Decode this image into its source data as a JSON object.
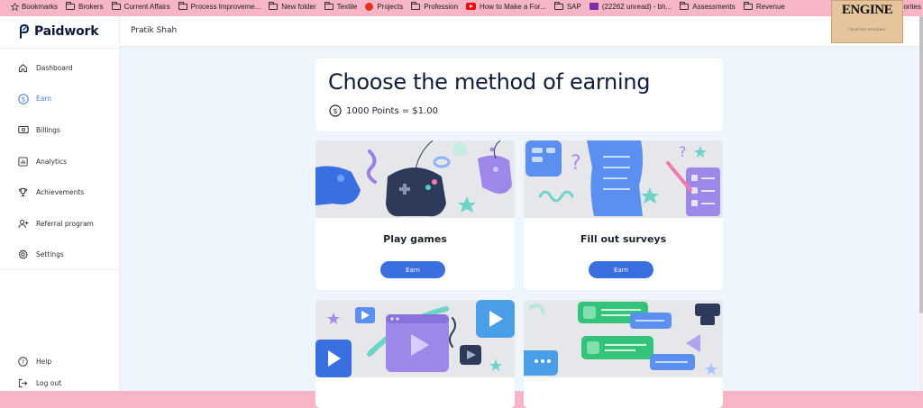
{
  "bookmarks": {
    "items": [
      {
        "label": "Bookmarks",
        "icon": "star-icon"
      },
      {
        "label": "Brokers",
        "icon": "folder-icon"
      },
      {
        "label": "Current Affairs",
        "icon": "folder-icon"
      },
      {
        "label": "Process Improveme...",
        "icon": "folder-icon"
      },
      {
        "label": "New folder",
        "icon": "folder-icon"
      },
      {
        "label": "Textile",
        "icon": "folder-icon"
      },
      {
        "label": "Projects",
        "icon": "site-icon"
      },
      {
        "label": "Profession",
        "icon": "folder-icon"
      },
      {
        "label": "How to Make a For...",
        "icon": "youtube-icon"
      },
      {
        "label": "SAP",
        "icon": "folder-icon"
      },
      {
        "label": "(22262 unread) - bh...",
        "icon": "mail-icon"
      },
      {
        "label": "Assessments",
        "icon": "folder-icon"
      },
      {
        "label": "Revenue",
        "icon": "folder-icon"
      }
    ],
    "overflow_label": "orites"
  },
  "overlay_thumb": {
    "big": "ENGINE",
    "small": "TRUSTED REVIEWS"
  },
  "app": {
    "logo": "Paidwork",
    "user_name": "Pratik Shah",
    "nav": [
      {
        "label": "Dashboard",
        "icon": "home-icon",
        "active": false
      },
      {
        "label": "Earn",
        "icon": "dollar-icon",
        "active": true
      },
      {
        "label": "Billings",
        "icon": "billing-icon",
        "active": false
      },
      {
        "label": "Analytics",
        "icon": "analytics-icon",
        "active": false
      },
      {
        "label": "Achievements",
        "icon": "trophy-icon",
        "active": false
      },
      {
        "label": "Referral program",
        "icon": "referral-icon",
        "active": false
      },
      {
        "label": "Settings",
        "icon": "gear-icon",
        "active": false
      }
    ],
    "nav_bottom": [
      {
        "label": "Help",
        "icon": "help-icon"
      },
      {
        "label": "Log out",
        "icon": "logout-icon"
      }
    ],
    "accent": "#3a6fe0"
  },
  "main": {
    "title": "Choose the method of earning",
    "points_rate": "1000 Points = $1.00",
    "cards": [
      {
        "title": "Play games",
        "button": "Earn",
        "art": "games-illustration"
      },
      {
        "title": "Fill out surveys",
        "button": "Earn",
        "art": "surveys-illustration"
      },
      {
        "title": "",
        "button": "",
        "art": "videos-illustration"
      },
      {
        "title": "",
        "button": "",
        "art": "tasks-illustration"
      }
    ]
  }
}
